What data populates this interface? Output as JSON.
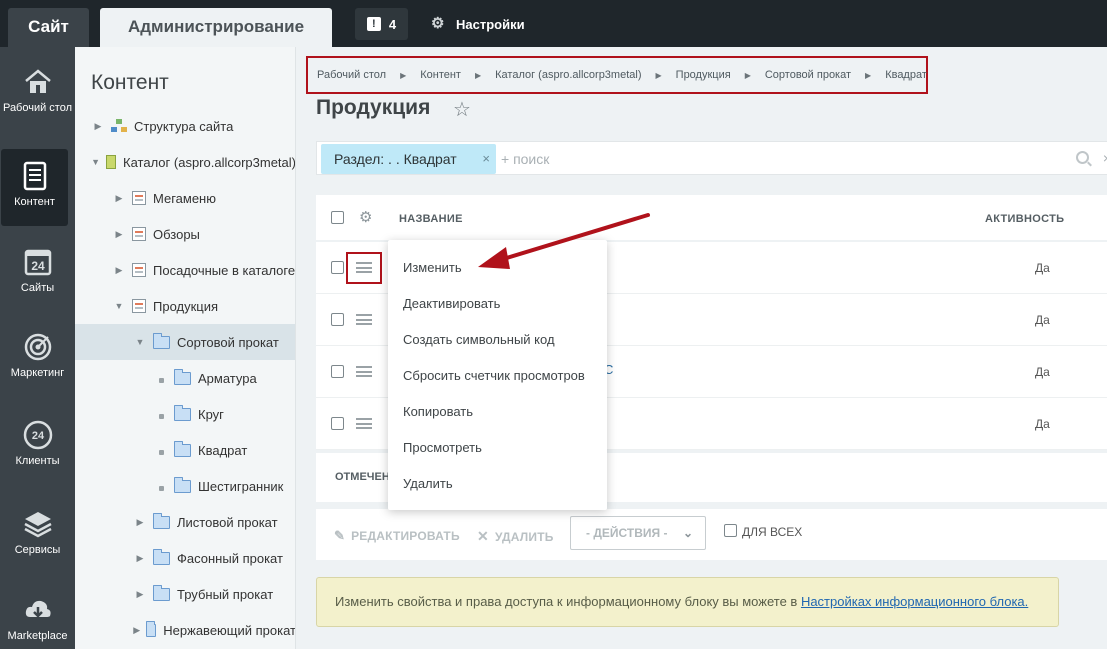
{
  "topbar": {
    "site_tab": "Сайт",
    "admin_tab": "Администрирование",
    "notifications_count": "4",
    "settings_label": "Настройки"
  },
  "leftnav": {
    "items": [
      {
        "label": "Рабочий стол",
        "icon": "home-icon"
      },
      {
        "label": "Контент",
        "icon": "document-icon",
        "active": true
      },
      {
        "label": "Сайты",
        "icon": "calendar-24-icon"
      },
      {
        "label": "Маркетинг",
        "icon": "target-icon"
      },
      {
        "label": "Клиенты",
        "icon": "clients-24-icon"
      },
      {
        "label": "Сервисы",
        "icon": "layers-icon"
      },
      {
        "label": "Marketplace",
        "icon": "cloud-download-icon"
      }
    ]
  },
  "tree": {
    "title": "Контент",
    "items": [
      {
        "label": "Структура сайта",
        "icon": "structure-icon",
        "expander": "collapsed"
      },
      {
        "label": "Каталог (aspro.allcorp3metal)",
        "icon": "catalog-icon",
        "expander": "expanded"
      },
      {
        "label": "Мегаменю",
        "icon": "list-icon",
        "expander": "collapsed"
      },
      {
        "label": "Обзоры",
        "icon": "list-icon",
        "expander": "collapsed"
      },
      {
        "label": "Посадочные в каталоге",
        "icon": "list-icon",
        "expander": "collapsed"
      },
      {
        "label": "Продукция",
        "icon": "list-icon",
        "expander": "expanded"
      },
      {
        "label": "Сортовой прокат",
        "icon": "folder-icon",
        "expander": "expanded",
        "selected": true
      },
      {
        "label": "Арматура",
        "icon": "folder-icon",
        "expander": "leaf"
      },
      {
        "label": "Круг",
        "icon": "folder-icon",
        "expander": "leaf"
      },
      {
        "label": "Квадрат",
        "icon": "folder-icon",
        "expander": "leaf"
      },
      {
        "label": "Шестигранник",
        "icon": "folder-icon",
        "expander": "leaf"
      },
      {
        "label": "Листовой прокат",
        "icon": "folder-icon",
        "expander": "collapsed"
      },
      {
        "label": "Фасонный прокат",
        "icon": "folder-icon",
        "expander": "collapsed"
      },
      {
        "label": "Трубный прокат",
        "icon": "folder-icon",
        "expander": "collapsed"
      },
      {
        "label": "Нержавеющий прокат",
        "icon": "folder-icon",
        "expander": "collapsed"
      }
    ]
  },
  "breadcrumb": [
    "Рабочий стол",
    "Контент",
    "Каталог (aspro.allcorp3metal)",
    "Продукция",
    "Сортовой прокат",
    "Квадрат"
  ],
  "page": {
    "title": "Продукция"
  },
  "filter": {
    "chip_label": "Раздел: . . Квадрат",
    "chip_close": "×",
    "search_placeholder": "+ поиск",
    "edge_close": "×"
  },
  "grid": {
    "col_name": "НАЗВАНИЕ",
    "col_active": "АКТИВНОСТЬ",
    "rows": [
      {
        "active": "Да",
        "partial_text": ""
      },
      {
        "active": "Да",
        "partial_text": ""
      },
      {
        "active": "Да",
        "partial_text": "С"
      },
      {
        "active": "Да",
        "partial_text": ""
      }
    ],
    "footer_label": "ОТМЕЧЕН"
  },
  "actions": {
    "edit": "РЕДАКТИРОВАТЬ",
    "delete": "УДАЛИТЬ",
    "select": "- ДЕЙСТВИЯ -",
    "for_all": "ДЛЯ ВСЕХ"
  },
  "notice": {
    "text": "Изменить свойства и права доступа к информационному блоку вы можете в ",
    "link": "Настройках информационного блока."
  },
  "context_menu": {
    "items": [
      "Изменить",
      "Деактивировать",
      "Создать символьный код",
      "Сбросить счетчик просмотров",
      "Копировать",
      "Просмотреть",
      "Удалить"
    ]
  },
  "colors": {
    "topbar": "#1f262b",
    "leftnav": "#3b4349",
    "highlight_annotation": "#b0121b",
    "chip": "#bfe9f8",
    "notice": "#f3f1cc",
    "link": "#2067b0"
  }
}
